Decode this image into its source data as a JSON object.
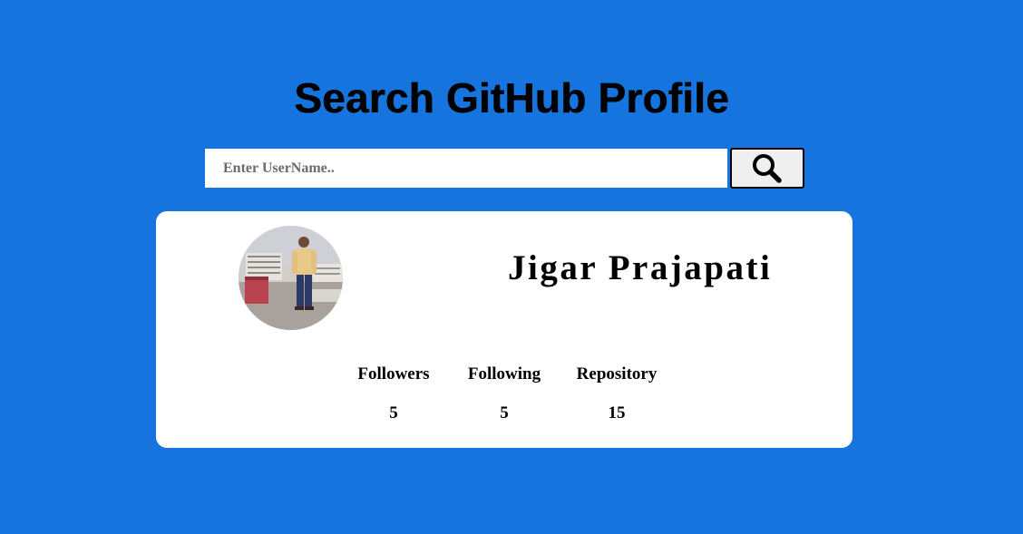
{
  "header": {
    "title": "Search GitHub Profile"
  },
  "search": {
    "placeholder": "Enter UserName..",
    "value": "",
    "button_icon": "search-icon"
  },
  "profile": {
    "name": "Jigar Prajapati",
    "stats": [
      {
        "label": "Followers",
        "value": "5"
      },
      {
        "label": "Following",
        "value": "5"
      },
      {
        "label": "Repository",
        "value": "15"
      }
    ]
  },
  "colors": {
    "background": "#1574de",
    "card": "#ffffff",
    "button": "#efefef"
  }
}
